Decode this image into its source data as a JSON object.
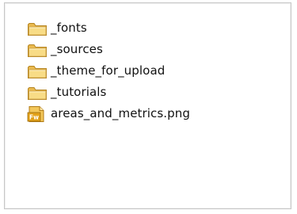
{
  "files": [
    {
      "name": "_fonts",
      "icon": "folder-icon"
    },
    {
      "name": "_sources",
      "icon": "folder-icon"
    },
    {
      "name": "_theme_for_upload",
      "icon": "folder-icon"
    },
    {
      "name": "_tutorials",
      "icon": "folder-icon"
    },
    {
      "name": "areas_and_metrics.png",
      "icon": "fireworks-png-icon",
      "badge": "Fw"
    }
  ],
  "colors": {
    "folder_light": "#f8dc86",
    "folder_dark": "#d6a43a",
    "fw_badge": "#e3a21a"
  }
}
